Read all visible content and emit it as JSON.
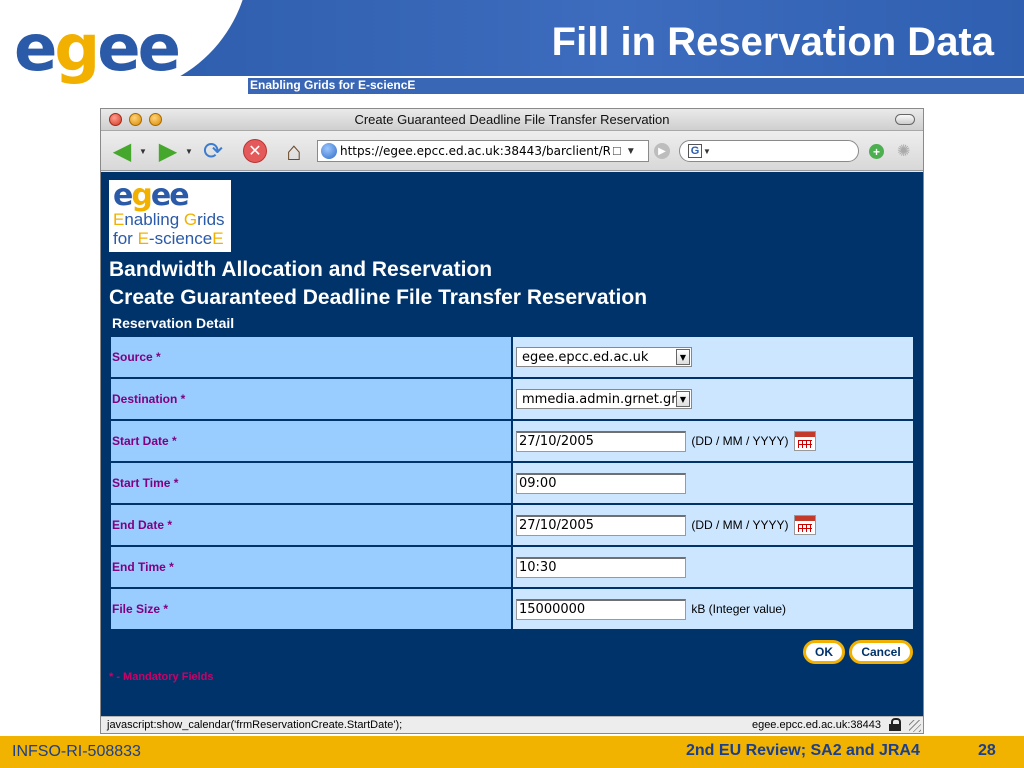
{
  "slide": {
    "logo_text_e1": "e",
    "logo_text_g": "g",
    "logo_text_ee": "ee",
    "title": "Fill in Reservation Data",
    "tagline": "Enabling Grids for E-sciencE",
    "footer_left": "INFSO-RI-508833",
    "footer_mid": "2nd EU Review; SA2 and JRA4",
    "page_number": "28",
    "colors": {
      "header_blue": "#2a59a8",
      "footer_gold": "#f2b200",
      "page_bg": "#00336a"
    }
  },
  "browser": {
    "window_title": "Create Guaranteed Deadline File Transfer Reservation",
    "url": "https://egee.epcc.ed.ac.uk:38443/barclient/R",
    "search_engine_glyph": "G",
    "icons": [
      "back-arrow-icon",
      "forward-arrow-icon",
      "reload-icon",
      "stop-icon",
      "home-icon",
      "globe-icon",
      "lock-icon",
      "go-icon",
      "google-icon",
      "add-icon",
      "spinner-icon"
    ],
    "status_left": "javascript:show_calendar('frmReservationCreate.StartDate');",
    "status_right": "egee.epcc.ed.ac.uk:38443"
  },
  "page": {
    "logo": {
      "e1": "e",
      "g": "g",
      "ee": "ee",
      "line1_e": "E",
      "line1_rest": "nabling ",
      "line1_g": "G",
      "line1_rest2": "rids",
      "line2_pre": "for ",
      "line2_e": "E",
      "line2_mid": "-science",
      "line2_end": "E"
    },
    "heading1": "Bandwidth Allocation and Reservation",
    "heading2": "Create Guaranteed Deadline File Transfer Reservation",
    "section": "Reservation Detail",
    "form": {
      "source": {
        "label": "Source *",
        "value": "egee.epcc.ed.ac.uk"
      },
      "destination": {
        "label": "Destination *",
        "value": "mmedia.admin.grnet.gr"
      },
      "start_date": {
        "label": "Start Date *",
        "value": "27/10/2005",
        "hint": "(DD / MM / YYYY)"
      },
      "start_time": {
        "label": "Start Time *",
        "value": "09:00"
      },
      "end_date": {
        "label": "End Date *",
        "value": "27/10/2005",
        "hint": "(DD / MM / YYYY)"
      },
      "end_time": {
        "label": "End Time *",
        "value": "10:30"
      },
      "file_size": {
        "label": "File Size *",
        "value": "15000000",
        "hint": "kB (Integer value)"
      }
    },
    "ok_label": "OK",
    "cancel_label": "Cancel",
    "mandatory_note": "* - Mandatory Fields"
  }
}
